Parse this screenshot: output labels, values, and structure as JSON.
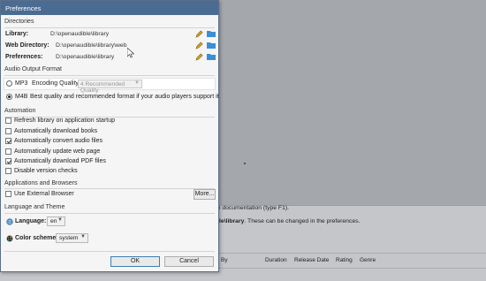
{
  "dialog": {
    "title": "Preferences"
  },
  "directories": {
    "section_title": "Directories",
    "rows": [
      {
        "label": "Library:",
        "path": "D:\\openaudible\\library"
      },
      {
        "label": "Web Directory:",
        "path": "D:\\openaudible\\library\\web"
      },
      {
        "label": "Preferences:",
        "path": "D:\\openaudible\\library"
      }
    ]
  },
  "audio": {
    "section_title": "Audio Output Format",
    "mp3_label": "MP3",
    "encoding_label": "Encoding Quality",
    "encoding_value": "4 Recommended Quality",
    "m4b_label": "M4B",
    "m4b_desc": "Best quality and recommended format if your audio players support it",
    "selected": "M4B"
  },
  "automation": {
    "section_title": "Automation",
    "items": [
      {
        "label": "Refresh library on application startup",
        "checked": false
      },
      {
        "label": "Automatically download books",
        "checked": false
      },
      {
        "label": "Automatically convert audio files",
        "checked": true
      },
      {
        "label": "Automatically update web page",
        "checked": false
      },
      {
        "label": "Automatically download PDF files",
        "checked": true
      },
      {
        "label": "Disable version checks",
        "checked": false
      }
    ]
  },
  "apps": {
    "section_title": "Applications and Browsers",
    "external_browser_label": "Use External Browser",
    "external_browser_checked": false,
    "more_button": "More..."
  },
  "language_theme": {
    "section_title": "Language and Theme",
    "language_label": "Language:",
    "language_value": "en",
    "color_label": "Color scheme:",
    "color_value": "system"
  },
  "buttons": {
    "ok": "OK",
    "cancel": "Cancel"
  },
  "background": {
    "line1": "he documentation (type F1).",
    "line2_bold": "ible\\library",
    "line2_rest": ". These can be changed in the preferences.",
    "columns": [
      "By",
      "Duration",
      "Release Date",
      "Rating",
      "Genre"
    ]
  },
  "colors": {
    "titlebar": "#4b6c92",
    "dialog_bg": "#f5f5f5",
    "folder": "#3a8fd6",
    "pencil": "#d8a020"
  }
}
